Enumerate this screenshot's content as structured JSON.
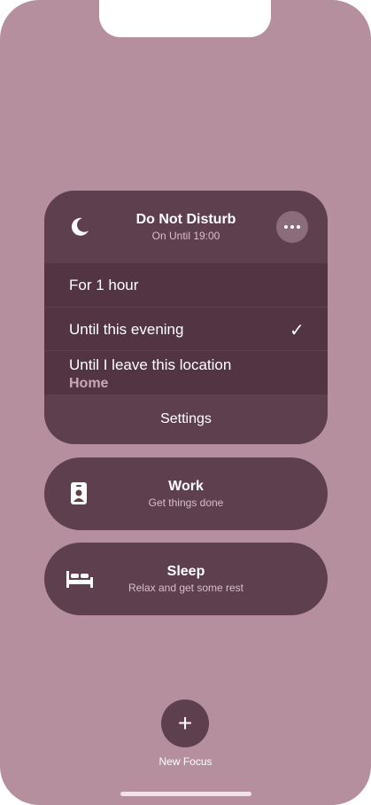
{
  "focus": {
    "title": "Do Not Disturb",
    "subtitle": "On Until 19:00",
    "options": [
      {
        "label": "For 1 hour",
        "selected": false
      },
      {
        "label": "Until this evening",
        "selected": true
      },
      {
        "label": "Until I leave this location",
        "sublabel": "Home",
        "selected": false
      }
    ],
    "check": "✓",
    "settings_label": "Settings"
  },
  "modes": {
    "work": {
      "title": "Work",
      "subtitle": "Get things done",
      "icon": "id-badge-icon"
    },
    "sleep": {
      "title": "Sleep",
      "subtitle": "Relax and get some rest",
      "icon": "bed-icon"
    }
  },
  "new_focus": {
    "icon": "+",
    "label": "New Focus"
  },
  "colors": {
    "background": "#b68f9f",
    "card": "#5e3f4e",
    "option_bg": "#523442",
    "accent_text": "#c9a7b7"
  }
}
